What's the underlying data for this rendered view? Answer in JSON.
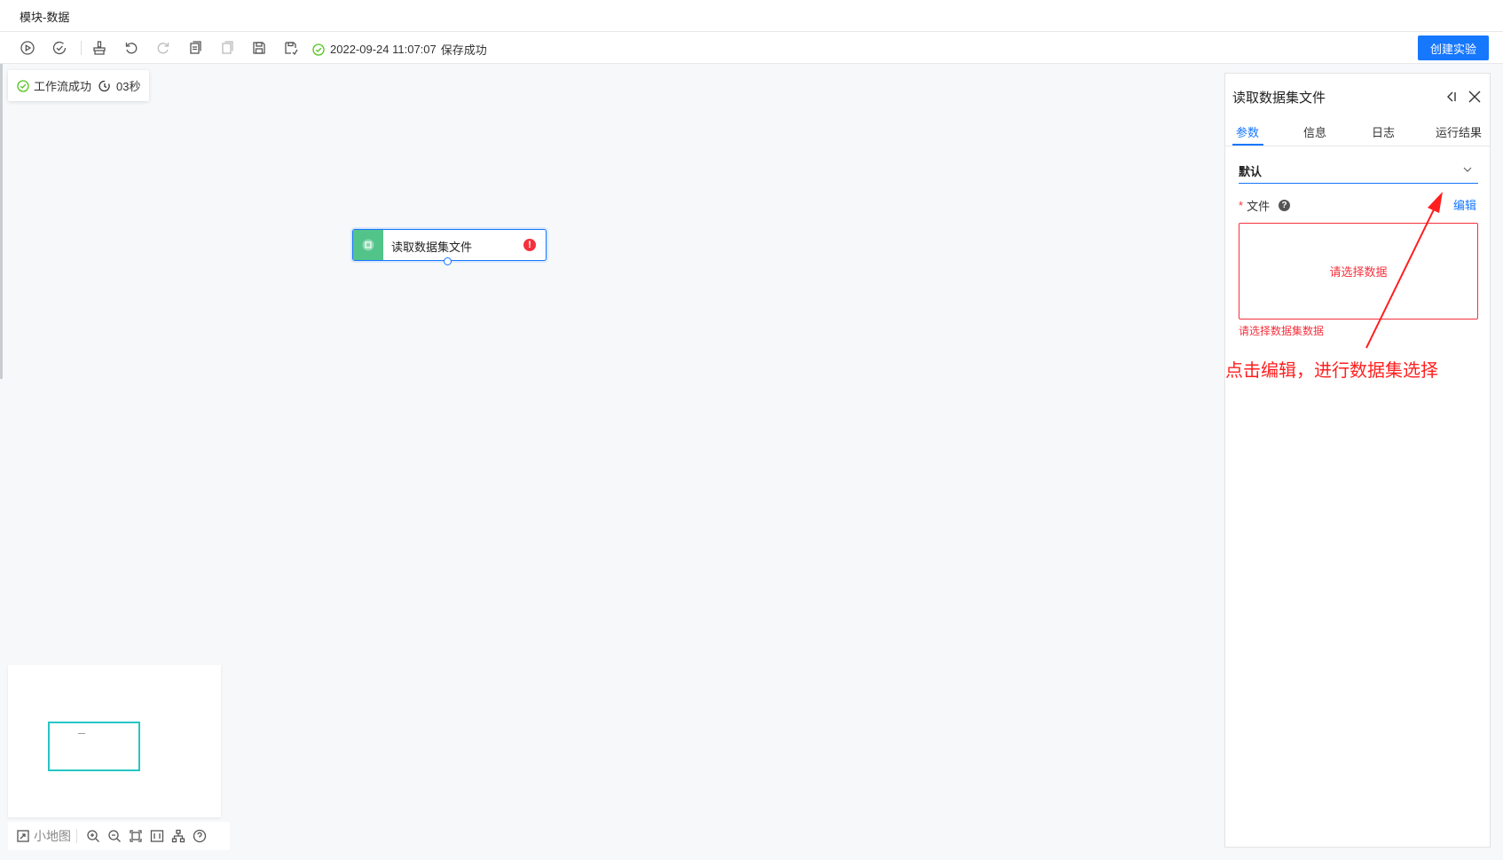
{
  "window": {
    "title": "模块-数据"
  },
  "toolbar": {
    "icons": [
      "run-icon",
      "check-run-icon",
      "clean-icon",
      "undo-icon",
      "redo-icon",
      "copy-icon",
      "paste-icon",
      "save-icon",
      "save-as-icon"
    ],
    "save_time": "2022-09-24 11:07:07",
    "save_status": "保存成功",
    "create_label": "创建实验",
    "accent": "#1677ff"
  },
  "workflow": {
    "status": "工作流成功",
    "duration": "03秒",
    "status_color": "#52c41a"
  },
  "node": {
    "label": "读取数据集文件",
    "icon_color": "#52c48a",
    "error_color": "#f5313d",
    "error_glyph": "!"
  },
  "minimap": {
    "label": "小地图"
  },
  "bottom_tools": [
    "minimap-icon",
    "zoom-in-icon",
    "zoom-out-icon",
    "fit-screen-icon",
    "actual-size-icon",
    "auto-layout-icon",
    "help-icon"
  ],
  "panel": {
    "title": "读取数据集文件",
    "tabs": [
      {
        "label": "参数",
        "active": true
      },
      {
        "label": "信息",
        "active": false
      },
      {
        "label": "日志",
        "active": false
      },
      {
        "label": "运行结果",
        "active": false
      }
    ],
    "group": "默认",
    "field": {
      "required_mark": "*",
      "label": "文件",
      "help_glyph": "?",
      "edit_label": "编辑",
      "placeholder": "请选择数据",
      "error": "请选择数据集数据"
    }
  },
  "annotation": {
    "text": "点击编辑，进行数据集选择",
    "color": "#ff1f1f"
  }
}
